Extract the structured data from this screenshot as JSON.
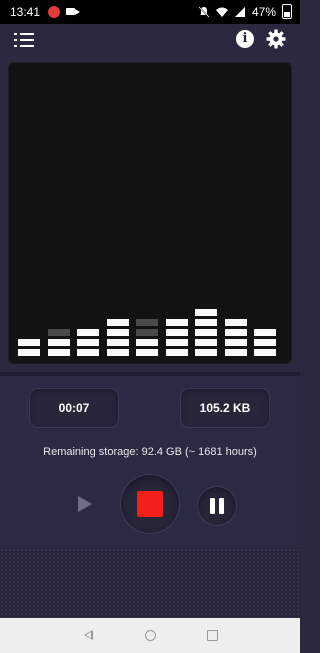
{
  "status_bar": {
    "time": "13:41",
    "battery": "47%",
    "icons": [
      "record-notification-icon",
      "video-camera-icon",
      "dnd-icon",
      "wifi-icon",
      "signal-icon",
      "battery-icon"
    ]
  },
  "app_bar": {
    "menu_icon": "list-menu-icon",
    "info_icon": "info-icon",
    "info_glyph": "i",
    "settings_icon": "gear-icon"
  },
  "visualizer": {
    "levels_segments": [
      2,
      2,
      3,
      4,
      3,
      4,
      5,
      4,
      3
    ],
    "dim_segments": [
      [],
      [
        3
      ],
      [],
      [],
      [
        3,
        4
      ],
      [],
      [],
      [],
      []
    ]
  },
  "recording": {
    "elapsed": "00:07",
    "size": "105.2 KB",
    "remaining_storage": "Remaining storage: 92.4 GB (~ 1681 hours)"
  },
  "controls": {
    "play_icon": "play-icon",
    "record_stop_icon": "stop-icon",
    "pause_icon": "pause-icon",
    "colors": {
      "record": "#f21f1a",
      "play_disabled": "#6e6d83"
    }
  },
  "nav_bar": {
    "back": "back-icon",
    "home": "home-icon",
    "recents": "recents-icon"
  }
}
